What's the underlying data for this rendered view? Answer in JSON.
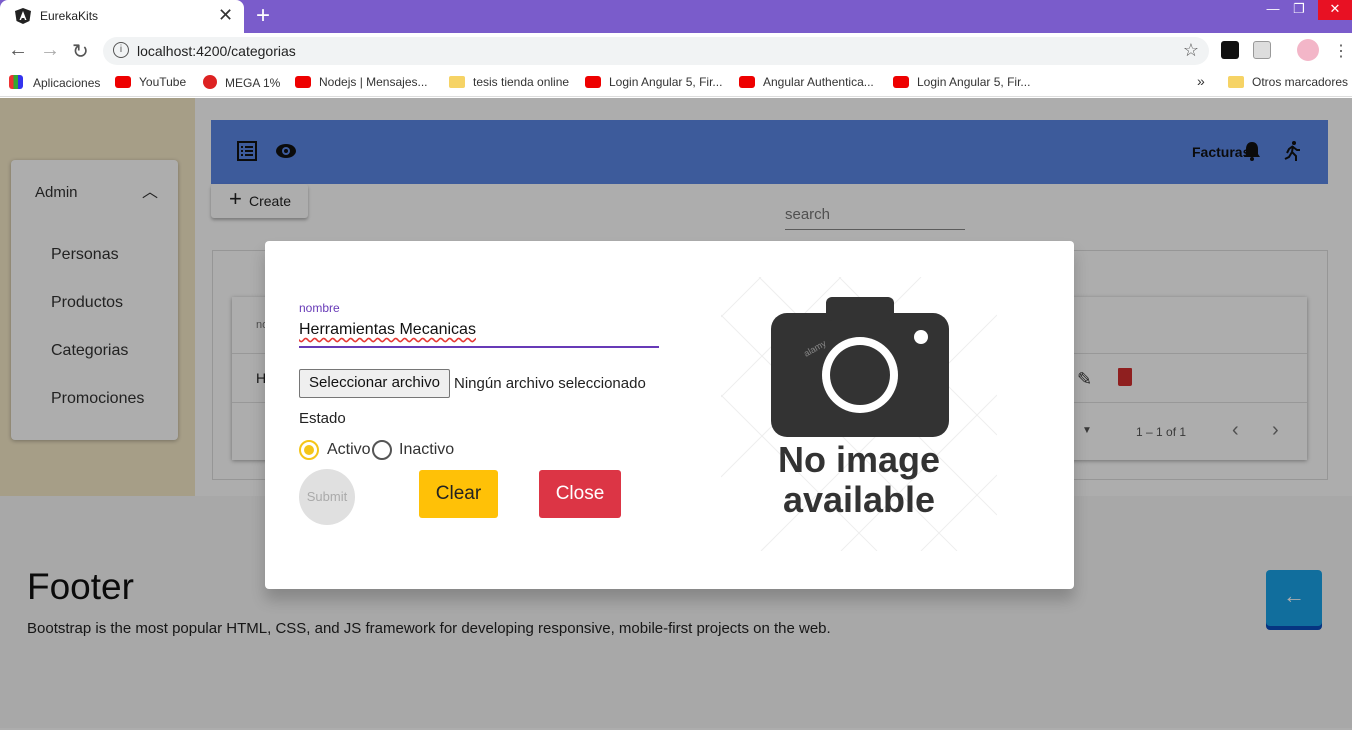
{
  "browser": {
    "tab_title": "EurekaKits",
    "url": "localhost:4200/categorias",
    "bookmarks": [
      {
        "label": "Aplicaciones",
        "icon": "apps-grid-icon"
      },
      {
        "label": "YouTube",
        "icon": "youtube-icon"
      },
      {
        "label": "MEGA 1%",
        "icon": "mega-icon"
      },
      {
        "label": "Nodejs | Mensajes...",
        "icon": "youtube-icon"
      },
      {
        "label": "tesis tienda online",
        "icon": "folder-icon"
      },
      {
        "label": "Login Angular 5, Fir...",
        "icon": "youtube-icon"
      },
      {
        "label": "Angular Authentica...",
        "icon": "youtube-icon"
      },
      {
        "label": "Login Angular 5, Fir...",
        "icon": "youtube-icon"
      }
    ],
    "more_bookmarks": "»",
    "other_bookmarks": "Otros marcadores"
  },
  "sidebar": {
    "section": "Admin",
    "items": [
      {
        "label": "Personas"
      },
      {
        "label": "Productos"
      },
      {
        "label": "Categorias"
      },
      {
        "label": "Promociones"
      }
    ]
  },
  "topbar": {
    "facturas_label": "Facturas",
    "color": "#5b86e5"
  },
  "toolbar": {
    "create_label": "Create",
    "search_placeholder": "search"
  },
  "table": {
    "header_partial": "no",
    "row_partial": "H",
    "paginator": "1 – 1 of 1"
  },
  "dialog": {
    "nombre_label": "nombre",
    "nombre_value": "Herramientas Mecanicas",
    "file_button": "Seleccionar archivo",
    "file_status": "Ningún archivo seleccionado",
    "estado_label": "Estado",
    "radio_activo": "Activo",
    "radio_inactivo": "Inactivo",
    "radio_selected": "Activo",
    "submit_label": "Submit",
    "clear_label": "Clear",
    "close_label": "Close",
    "image_text_line1": "No image",
    "image_text_line2": "available",
    "image_watermark": "alamy"
  },
  "footer": {
    "title": "Footer",
    "text": "Bootstrap is the most popular HTML, CSS, and JS framework for developing responsive, mobile-first projects on the web."
  },
  "colors": {
    "tabstrip": "#7a5ccb",
    "clear": "#ffc107",
    "close": "#dc3545",
    "accent": "#673ab7",
    "back_button": "#1aa3e8"
  }
}
